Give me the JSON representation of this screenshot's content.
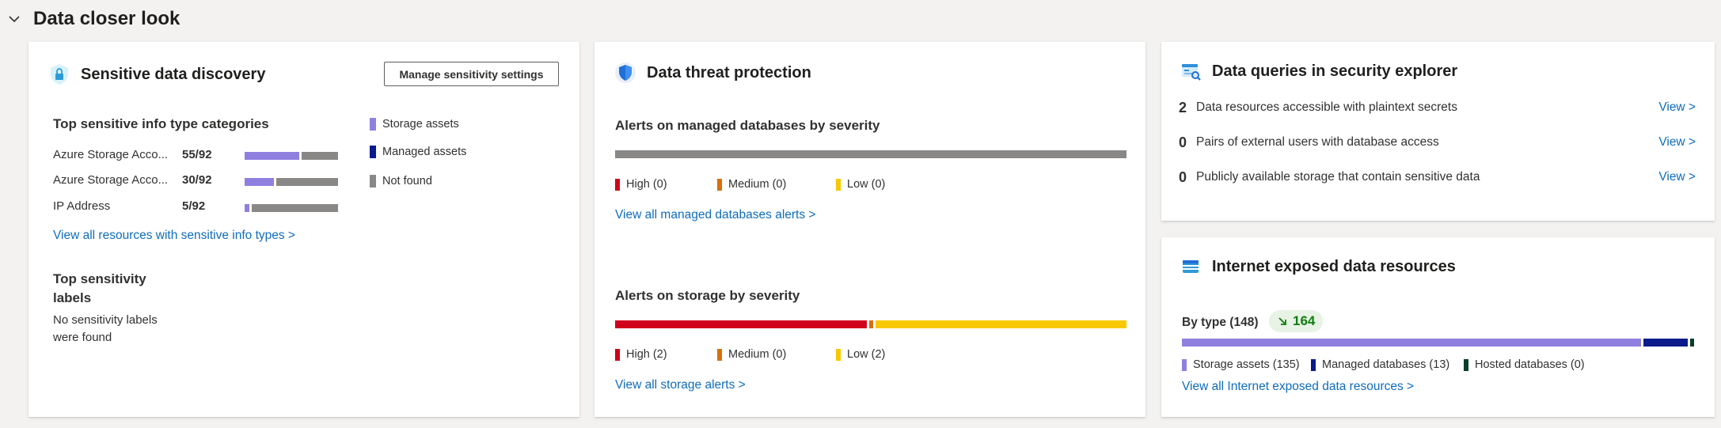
{
  "section": {
    "title": "Data closer look"
  },
  "sensitive": {
    "title": "Sensitive data discovery",
    "manage_button": "Manage sensitivity settings",
    "categories_title": "Top sensitive info type categories",
    "rows": [
      {
        "label": "Azure Storage Acco...",
        "value": "55/92",
        "fraction": 0.598
      },
      {
        "label": "Azure Storage Acco...",
        "value": "30/92",
        "fraction": 0.326
      },
      {
        "label": "IP Address",
        "value": "5/92",
        "fraction": 0.054
      }
    ],
    "legend": [
      "Storage assets",
      "Managed assets",
      "Not found"
    ],
    "view_all_link": "View all resources with sensitive info types >",
    "labels_title_line1": "Top sensitivity",
    "labels_title_line2": "labels",
    "labels_empty_line1": "No sensitivity labels",
    "labels_empty_line2": "were found"
  },
  "threat": {
    "title": "Data threat protection",
    "db_title": "Alerts on managed databases by severity",
    "db_legend": [
      "High (0)",
      "Medium (0)",
      "Low (0)"
    ],
    "db_counts": {
      "high": 0,
      "medium": 0,
      "low": 0
    },
    "db_link": "View all managed databases alerts >",
    "storage_title": "Alerts on storage by severity",
    "storage_legend": [
      "High (2)",
      "Medium (0)",
      "Low (2)"
    ],
    "storage_counts": {
      "high": 2,
      "medium": 0,
      "low": 2
    },
    "storage_link": "View all storage alerts >"
  },
  "queries": {
    "title": "Data queries in security explorer",
    "rows": [
      {
        "count": "2",
        "label": "Data resources accessible with plaintext secrets",
        "view": "View >"
      },
      {
        "count": "0",
        "label": "Pairs of external users with database access",
        "view": "View >"
      },
      {
        "count": "0",
        "label": "Publicly available storage that contain sensitive data",
        "view": "View >"
      }
    ]
  },
  "internet": {
    "title": "Internet exposed data resources",
    "by_type": "By type (148)",
    "trend_value": "164",
    "counts": {
      "storage": 135,
      "managed": 13,
      "hosted": 0
    },
    "legend": [
      "Storage assets (135)",
      "Managed databases (13)",
      "Hosted databases (0)"
    ],
    "view_all_link": "View all Internet exposed data resources >"
  },
  "colors": {
    "storage": "#8f80e0",
    "managed": "#0b1b8c",
    "not_found": "#8a8886",
    "high": "#d0021b",
    "medium": "#d8700a",
    "low": "#f8c800",
    "hosted": "#0b3d2e",
    "link": "#0f6cbd"
  }
}
